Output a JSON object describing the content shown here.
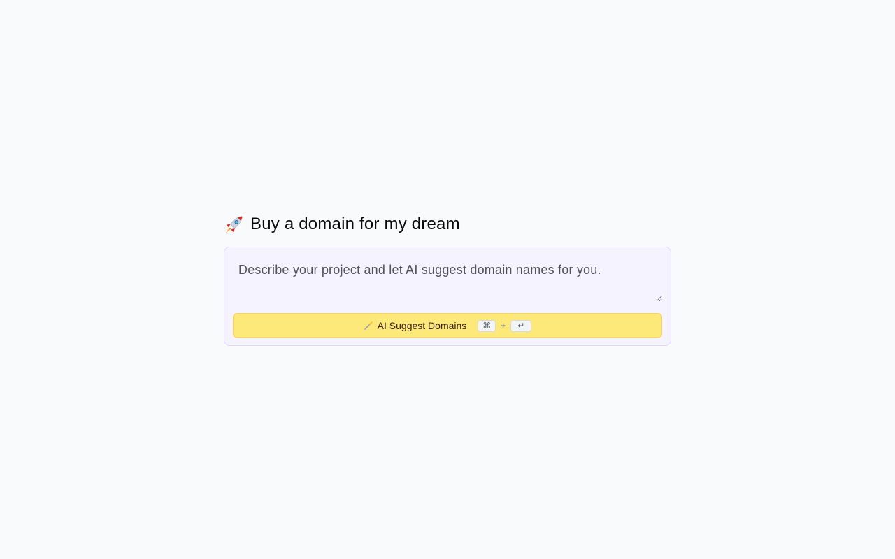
{
  "page": {
    "heading": "Buy a domain for my dream",
    "heading_icon": "rocket-icon"
  },
  "prompt": {
    "value": "",
    "placeholder": "Describe your project and let AI suggest domain names for you."
  },
  "suggest_button": {
    "icon": "magic-wand-icon",
    "label": "AI Suggest Domains",
    "shortcut_modifier": "⌘",
    "shortcut_plus": "+",
    "shortcut_key": "↵"
  },
  "colors": {
    "background": "#f8fafc",
    "card_background": "#f5f3ff",
    "card_border": "#ddd6fe",
    "button_background": "#fde87a",
    "button_border": "#f6d25f",
    "button_text": "#3b1d0e"
  }
}
